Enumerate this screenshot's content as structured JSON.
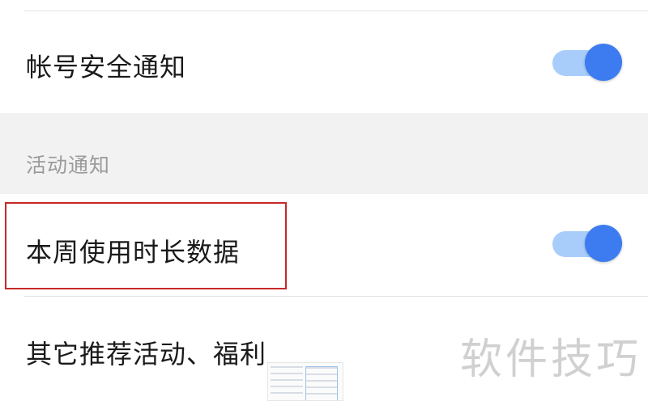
{
  "rows": [
    {
      "label": "帐号安全通知",
      "toggle_on": true
    },
    {
      "label": "本周使用时长数据",
      "toggle_on": true
    },
    {
      "label": "其它推荐活动、福利"
    }
  ],
  "section": {
    "title": "活动通知"
  },
  "watermark": {
    "text": "软件技巧"
  },
  "colors": {
    "toggle_track": "#a9cdfb",
    "toggle_knob": "#3c7cf0",
    "highlight_border": "#c62828",
    "section_background": "#f2f2f2"
  }
}
